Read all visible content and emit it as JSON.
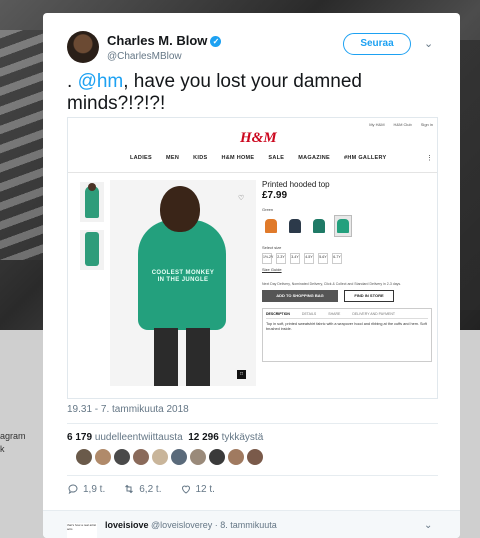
{
  "background": {
    "side_text_1": "agram",
    "side_text_2": "k"
  },
  "tweet": {
    "author_name": "Charles M. Blow",
    "handle": "@CharlesMBlow",
    "follow_label": "Seuraa",
    "text_prefix": ". ",
    "mention": "@hm",
    "text_suffix": ", have you lost your damned minds?!?!?!",
    "timestamp": "19.31 - 7. tammikuuta 2018",
    "retweets_count": "6 179",
    "retweets_label": "uudelleentwiittausta",
    "likes_count": "12 296",
    "likes_label": "tykkäystä",
    "reply_count": "1,9 t.",
    "retweet_count_short": "6,2 t.",
    "like_count_short": "12 t.",
    "liker_colors": [
      "#6a5a4a",
      "#b08a6a",
      "#4a4a4a",
      "#8a6a5a",
      "#c9b59a",
      "#5a6a7a",
      "#9a8a7a",
      "#3a3a3a",
      "#a07a60",
      "#7a5a4a"
    ]
  },
  "screenshot": {
    "top_links": [
      "My H&M",
      "H&M Club",
      "Sign in"
    ],
    "logo": "H&M",
    "nav": [
      "LADIES",
      "MEN",
      "KIDS",
      "H&M HOME",
      "SALE",
      "MAGAZINE",
      "#HM GALLERY"
    ],
    "product_title": "Printed hooded top",
    "price": "£7.99",
    "color_label": "Green",
    "swatch_colors": [
      "#e07a2a",
      "#2c3a4a",
      "#1f7a66",
      "#23a07d"
    ],
    "size_label": "Select size",
    "sizes": [
      "1½-2Y",
      "2-3Y",
      "3-4Y",
      "4-5Y",
      "5-6Y",
      "6-7Y"
    ],
    "size_guide": "Size Guide",
    "delivery": "Next Day Delivery, Nominated Delivery, Click & Collect and Standard Delivery in 2-3 days.",
    "add_to_bag": "ADD TO SHOPPING BAG",
    "find_in_store": "FIND IN STORE",
    "tabs": [
      "DESCRIPTION",
      "DETAILS",
      "SHARE",
      "DELIVERY AND PAYMENT"
    ],
    "description": "Top in soft, printed sweatshirt fabric with a wrapover hood and ribbing at the cuffs and hem. Soft brushed inside.",
    "print_text": "COOLEST MONKEY IN THE JUNGLE"
  },
  "reply": {
    "avatar_text": "that's how a real artist acts",
    "name": "loveisiove",
    "handle_date": "@loveisloverey · 8. tammikuuta"
  }
}
